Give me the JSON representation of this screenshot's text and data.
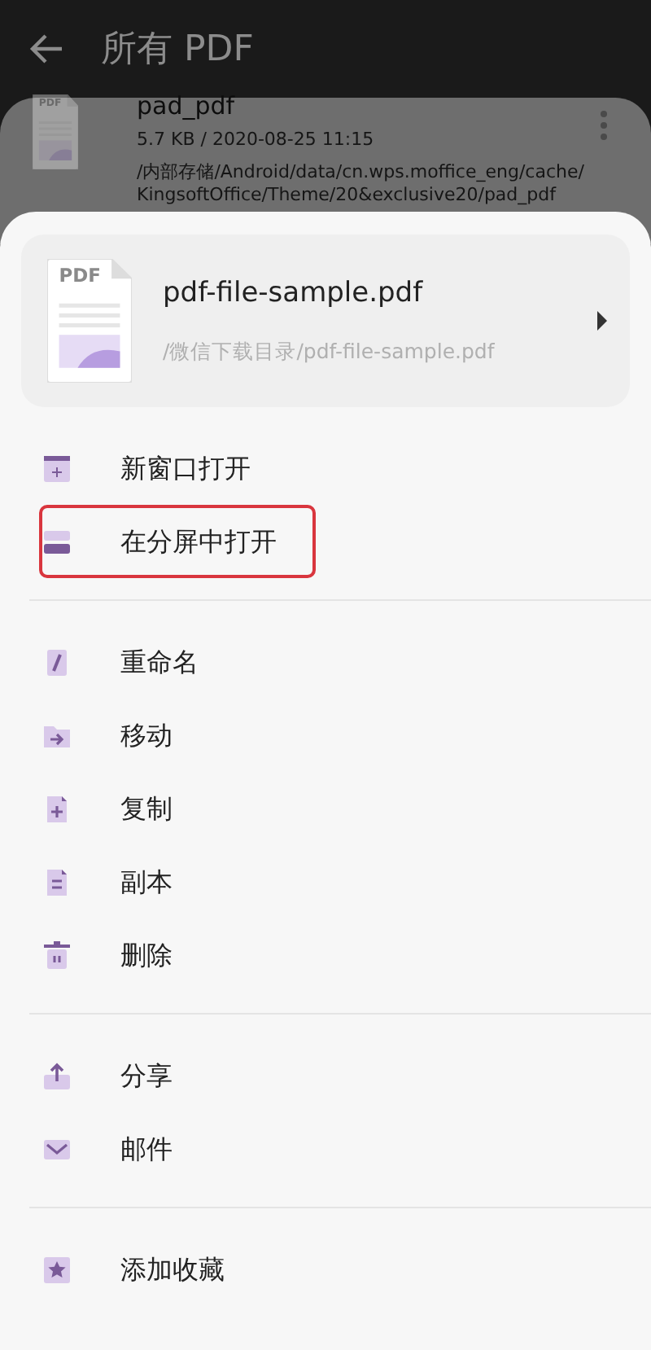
{
  "app_bar": {
    "title": "所有 PDF"
  },
  "background_file": {
    "icon_label": "PDF",
    "name": "pad_pdf",
    "meta": "5.7 KB / 2020-08-25 11:15",
    "path_lines": [
      "/内部存储/Android/data/cn.wps.moffice_eng/cache/",
      "KingsoftOffice/Theme/20&exclusive20/pad_pdf"
    ]
  },
  "sheet": {
    "file": {
      "icon_label": "PDF",
      "name": "pdf-file-sample.pdf",
      "path": "/微信下载目录/pdf-file-sample.pdf"
    },
    "groups": [
      {
        "items": [
          {
            "label": "新窗口打开",
            "kind": "new-window",
            "highlighted": false
          },
          {
            "label": "在分屏中打开",
            "kind": "split",
            "highlighted": true
          }
        ]
      },
      {
        "items": [
          {
            "label": "重命名",
            "kind": "pencil",
            "highlighted": false
          },
          {
            "label": "移动",
            "kind": "folder-arrow",
            "highlighted": false
          },
          {
            "label": "复制",
            "kind": "file-plus",
            "highlighted": false
          },
          {
            "label": "副本",
            "kind": "file-lines",
            "highlighted": false
          },
          {
            "label": "删除",
            "kind": "trash",
            "highlighted": false
          }
        ]
      },
      {
        "items": [
          {
            "label": "分享",
            "kind": "upload",
            "highlighted": false
          },
          {
            "label": "邮件",
            "kind": "mail",
            "highlighted": false
          }
        ]
      },
      {
        "items": [
          {
            "label": "添加收藏",
            "kind": "star",
            "highlighted": false
          }
        ]
      }
    ]
  }
}
